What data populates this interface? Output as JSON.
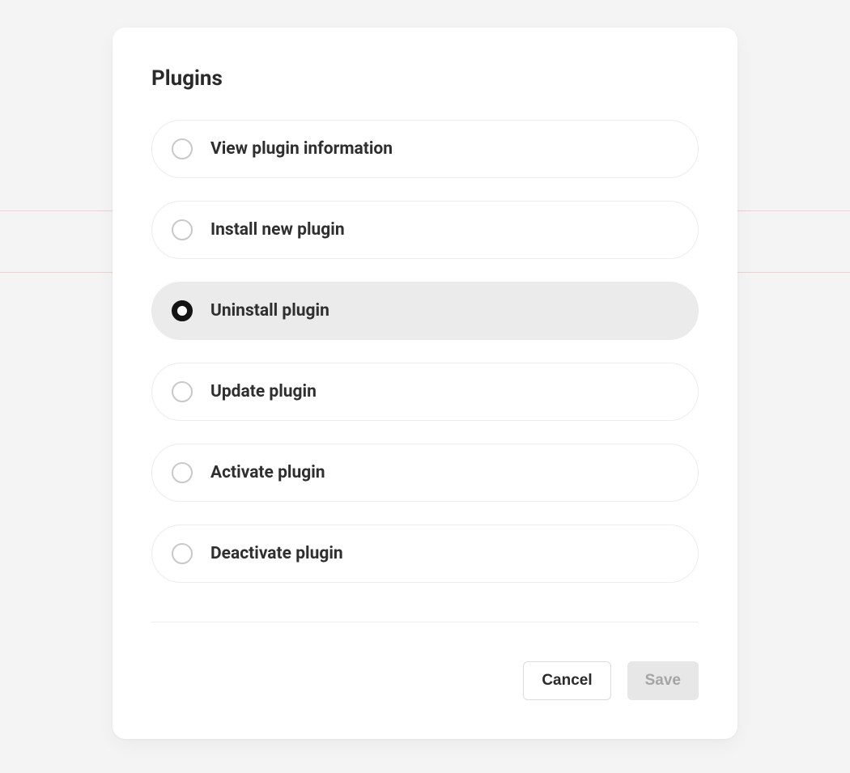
{
  "modal": {
    "title": "Plugins",
    "options": [
      {
        "label": "View plugin information",
        "selected": false
      },
      {
        "label": "Install new plugin",
        "selected": false
      },
      {
        "label": "Uninstall plugin",
        "selected": true
      },
      {
        "label": "Update plugin",
        "selected": false
      },
      {
        "label": "Activate plugin",
        "selected": false
      },
      {
        "label": "Deactivate plugin",
        "selected": false
      }
    ],
    "footer": {
      "cancel_label": "Cancel",
      "save_label": "Save"
    }
  }
}
